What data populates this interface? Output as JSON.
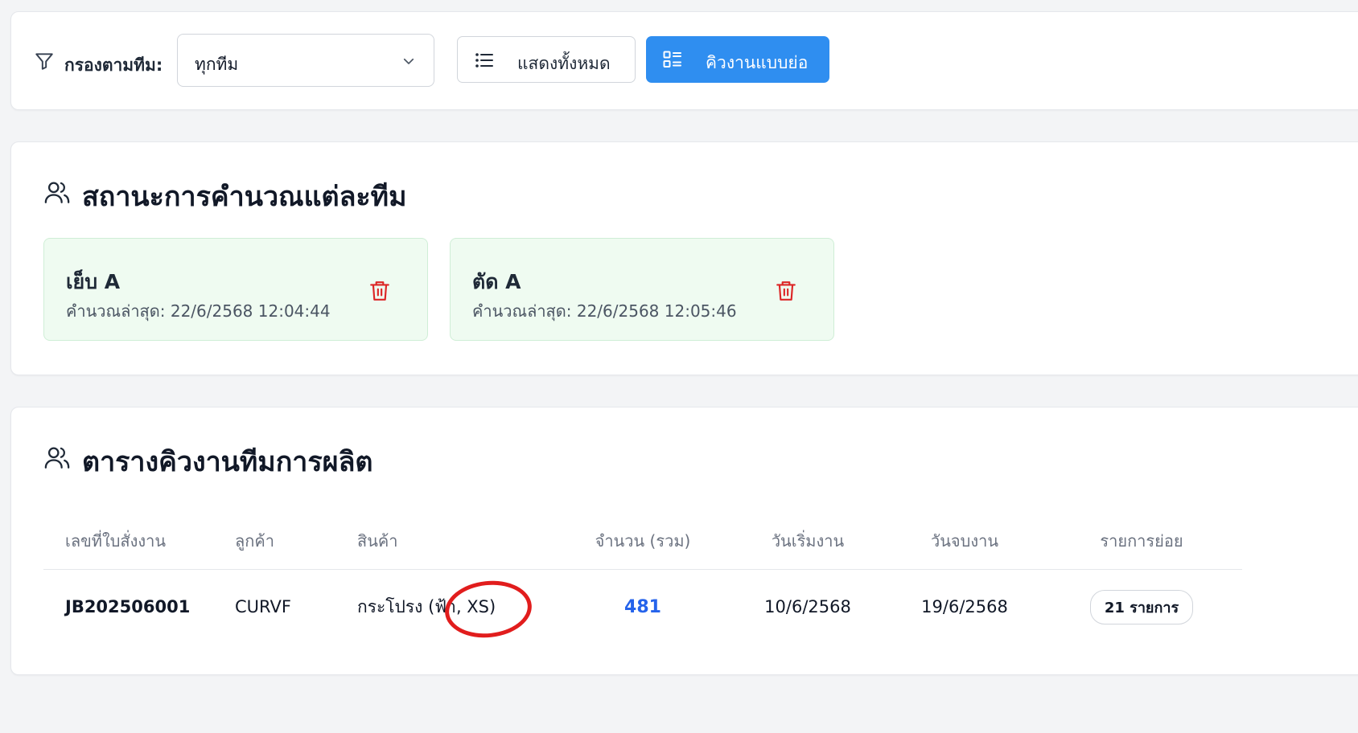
{
  "filter": {
    "label": "กรองตามทีม:",
    "selected_team": "ทุกทีม",
    "show_all_label": "แสดงทั้งหมด",
    "compact_label": "คิวงานแบบย่อ"
  },
  "team_status": {
    "title": "สถานะการคำนวณแต่ละทีม",
    "teams": [
      {
        "name": "เย็บ A",
        "last_calc": "คำนวณล่าสุด: 22/6/2568 12:04:44"
      },
      {
        "name": "ตัด A",
        "last_calc": "คำนวณล่าสุด: 22/6/2568 12:05:46"
      }
    ]
  },
  "queue": {
    "title": "ตารางคิวงานทีมการผลิต",
    "headers": [
      "เลขที่ใบสั่งงาน",
      "ลูกค้า",
      "สินค้า",
      "จำนวน (รวม)",
      "วันเริ่มงาน",
      "วันจบงาน",
      "รายการย่อย"
    ],
    "rows": [
      {
        "job_no": "JB202506001",
        "customer": "CURVF",
        "product": "กระโปรง (ฟ้า, XS)",
        "quantity": "481",
        "start_date": "10/6/2568",
        "end_date": "19/6/2568",
        "sub_items": "21 รายการ"
      }
    ]
  },
  "colors": {
    "primary": "#2f8ef0",
    "quantity": "#2563eb",
    "team_card_bg": "#effbf1",
    "trash": "#dc2626",
    "annotation": "#e11d1d"
  }
}
